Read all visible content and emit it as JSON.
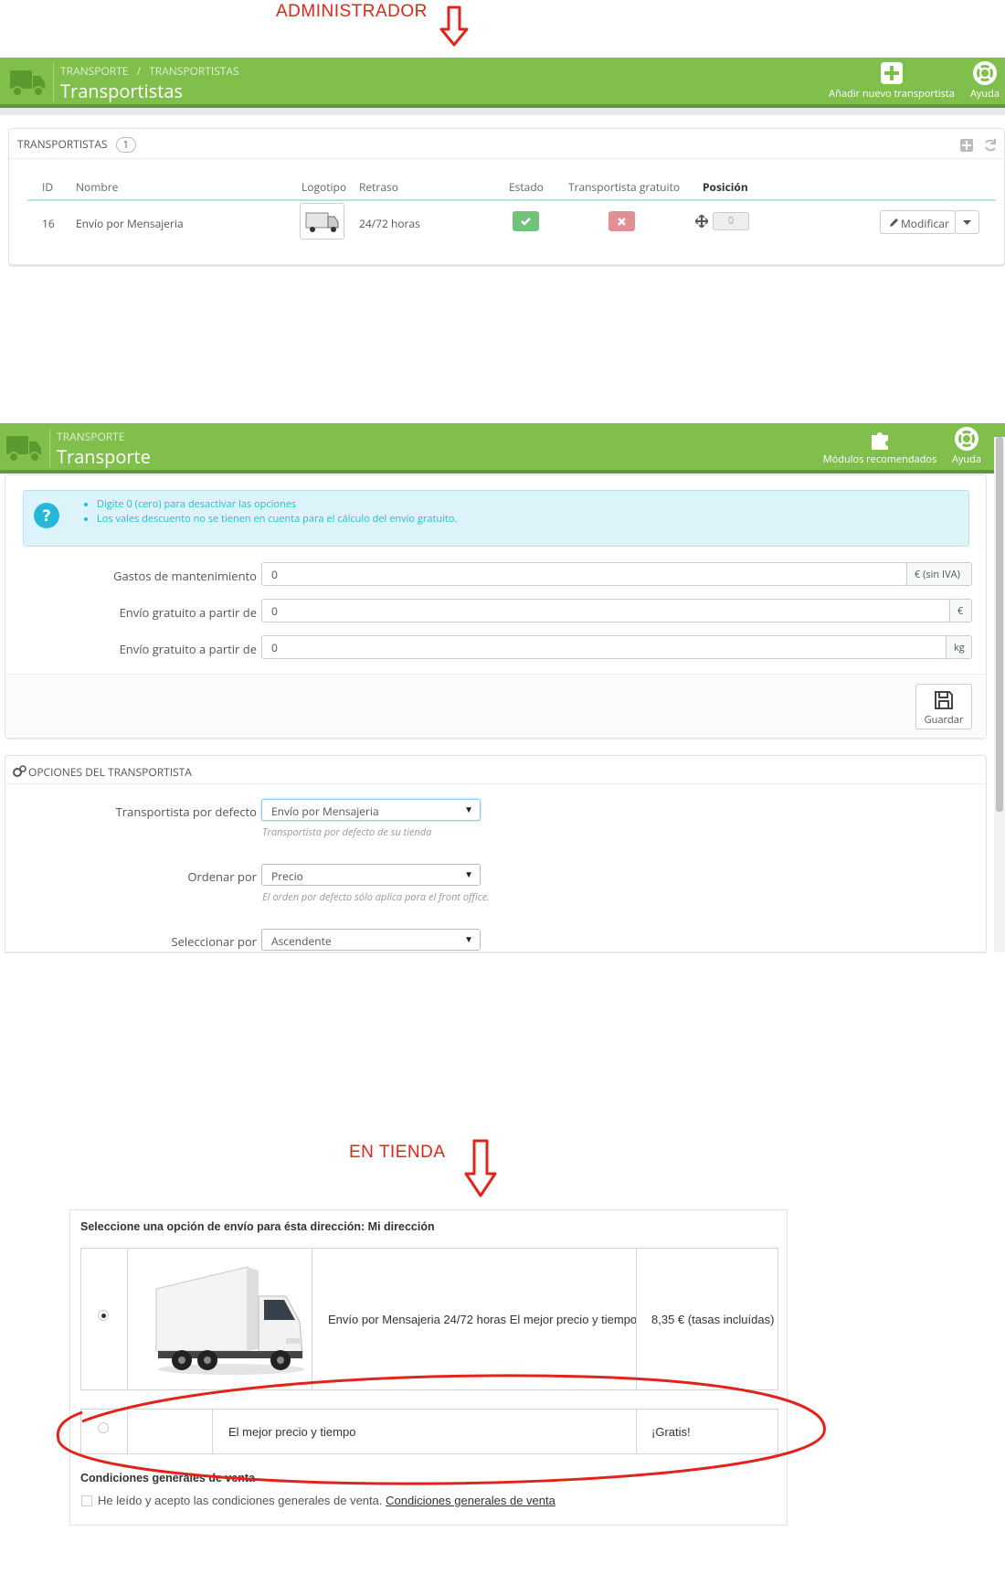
{
  "annotations": {
    "admin_label": "ADMINISTRADOR",
    "store_label": "EN TIENDA"
  },
  "carriers_page": {
    "breadcrumb": [
      "TRANSPORTE",
      "/",
      "TRANSPORTISTAS"
    ],
    "title": "Transportistas",
    "add_button": "Añadir nuevo transportista",
    "help_button": "Ayuda",
    "panel_title": "TRANSPORTISTAS",
    "panel_count": "1",
    "columns": [
      "ID",
      "Nombre",
      "Logotipo",
      "Retraso",
      "Estado",
      "Transportista gratuito",
      "Posición"
    ],
    "row": {
      "id": "16",
      "name": "Envío por Mensajeria",
      "delay": "24/72 horas",
      "position": "0",
      "edit_button": "Modificar"
    }
  },
  "shipping_page": {
    "breadcrumb": "TRANSPORTE",
    "title": "Transporte",
    "modules_button": "Módulos recomendados",
    "help_button": "Ayuda",
    "info_items": [
      "Digite 0 (cero) para desactivar las opciones",
      "Los vales descuento no se tienen en cuenta para el cálculo del envío gratuito."
    ],
    "fields": [
      {
        "label": "Gastos de mantenimiento",
        "value": "0",
        "addon": "€ (sin IVA)"
      },
      {
        "label": "Envío gratuito a partir de",
        "value": "0",
        "addon": "€"
      },
      {
        "label": "Envío gratuito a partir de",
        "value": "0",
        "addon": "kg"
      }
    ],
    "save_button": "Guardar",
    "options_title": "OPCIONES DEL TRANSPORTISTA",
    "selects": [
      {
        "label": "Transportista por defecto",
        "value": "Envío por Mensajeria",
        "help": "Transportista por defecto de su tienda"
      },
      {
        "label": "Ordenar por",
        "value": "Precio",
        "help": "El orden por defecto sólo aplica para el front office."
      },
      {
        "label": "Seleccionar por",
        "value": "Ascendente",
        "help": ""
      }
    ]
  },
  "store": {
    "heading": "Seleccione una opción de envío para ésta dirección: Mi dirección",
    "option1": {
      "description": "Envío por Mensajeria 24/72 horas El mejor precio y tiempo",
      "price": "8,35 € (tasas incluídas)"
    },
    "option2": {
      "description": "El mejor precio y tiempo",
      "price": "¡Gratis!"
    },
    "terms_title": "Condiciones generales de venta",
    "terms_text": "He leído y acepto las condiciones generales de venta.",
    "terms_link": "Condiciones generales de venta"
  },
  "colors": {
    "toolbar_green": "#80bf4c",
    "annotation_red": "#e0241b",
    "status_green": "#72c279",
    "status_red": "#e08f95",
    "info_blue": "#25b9d7"
  },
  "icons": [
    "truck-icon",
    "plus-square-icon",
    "lifebuoy-icon",
    "puzzle-icon",
    "check-icon",
    "x-icon",
    "move-icon",
    "pencil-icon",
    "save-icon",
    "cogs-icon",
    "question-icon"
  ]
}
